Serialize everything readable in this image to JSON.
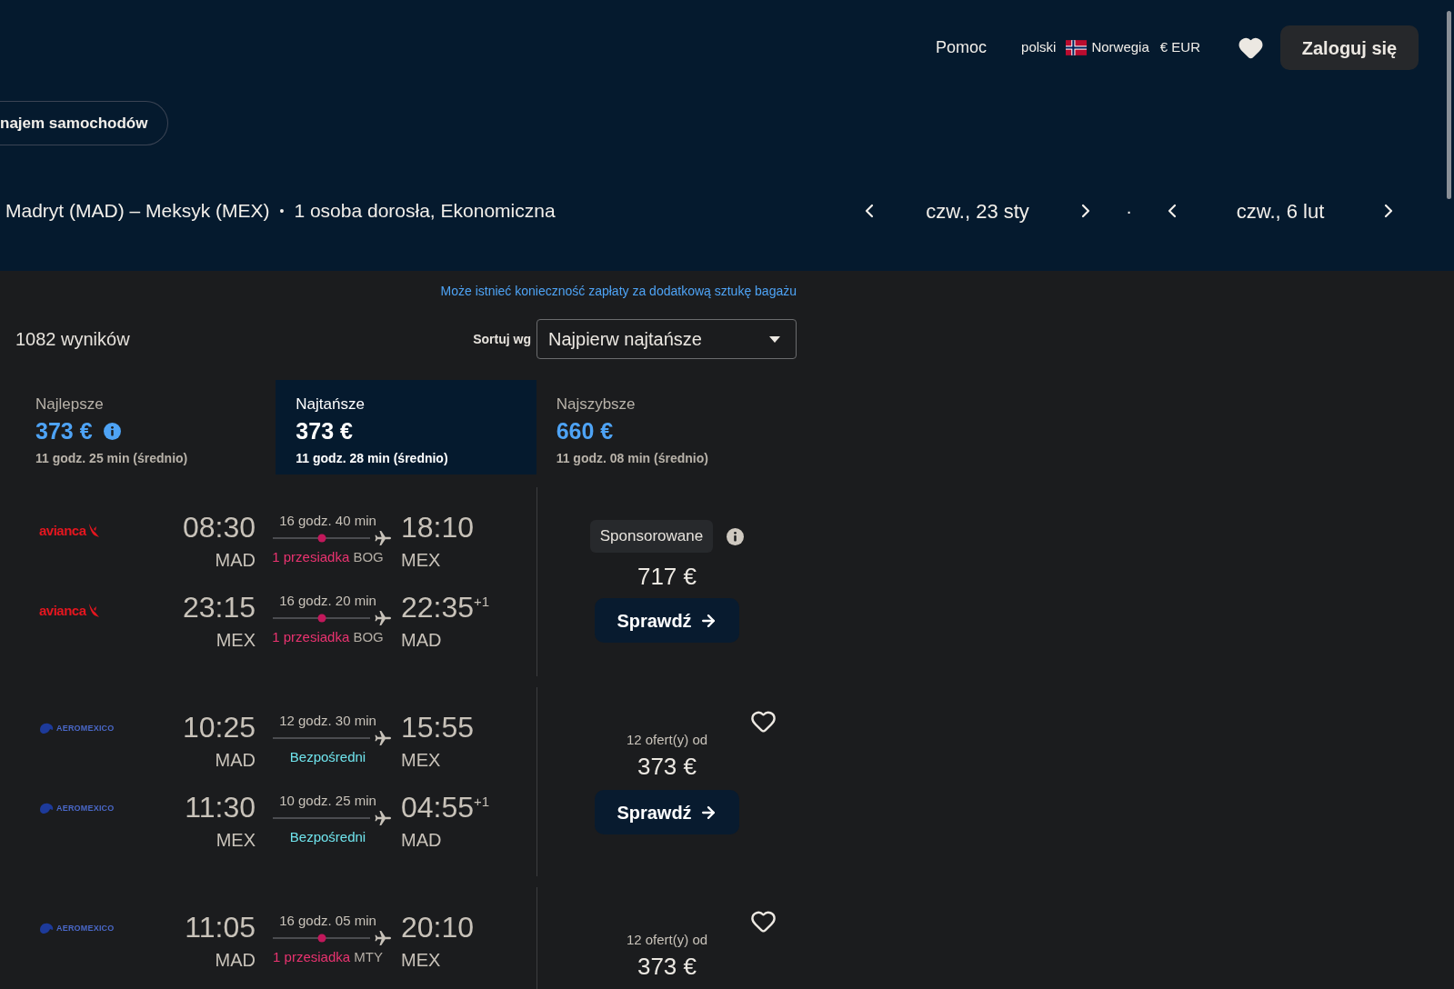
{
  "header": {
    "help_link": "Pomoc",
    "language": "polski",
    "country": "Norwegia",
    "currency": "€ EUR",
    "login_button": "Zaloguj się"
  },
  "category_pill": "najem samochodów",
  "search_summary": {
    "route": "Madryt (MAD) – Meksyk (MEX)",
    "separator": "•",
    "travellers": "1 osoba dorosła, Ekonomiczna",
    "dates": [
      "czw., 23 sty",
      "czw., 6 lut"
    ],
    "date_separator": "·"
  },
  "baggage_notice": "Może istnieć konieczność zapłaty za dodatkową sztukę bagażu",
  "results_count": "1082 wyników",
  "sort": {
    "label": "Sortuj wg",
    "value": "Najpierw najtańsze"
  },
  "sort_tabs": [
    {
      "label": "Najlepsze",
      "price": "373 €",
      "duration": "11 godz. 25 min (średnio)",
      "info": true,
      "selected": false
    },
    {
      "label": "Najtańsze",
      "price": "373 €",
      "duration": "11 godz. 28 min (średnio)",
      "info": false,
      "selected": true
    },
    {
      "label": "Najszybsze",
      "price": "660 €",
      "duration": "11 godz. 08 min (średnio)",
      "info": false,
      "selected": false
    }
  ],
  "results": [
    {
      "sponsored": "Sponsorowane",
      "price": "717 €",
      "button": "Sprawdź",
      "legs": [
        {
          "logo": {
            "kind": "bird",
            "text": "avianca"
          },
          "depart_time": "08:30",
          "depart_airport": "MAD",
          "duration": "16 godz. 40 min",
          "kind": "stop",
          "stops_label": "1 przesiadka",
          "stop_airport": "BOG",
          "arrive_time": "18:10",
          "arrive_airport": "MEX"
        },
        {
          "logo": {
            "kind": "bird",
            "text": "avianca"
          },
          "depart_time": "23:15",
          "depart_airport": "MEX",
          "duration": "16 godz. 20 min",
          "kind": "stop",
          "stops_label": "1 przesiadka",
          "stop_airport": "BOG",
          "arrive_time": "22:35",
          "day_offset": "+1",
          "arrive_airport": "MAD"
        }
      ]
    },
    {
      "saved": false,
      "offers_label": "12 ofert(y) od",
      "price": "373 €",
      "button": "Sprawdź",
      "legs": [
        {
          "logo": {
            "kind": "eagle",
            "text": "AEROMEXICO"
          },
          "depart_time": "10:25",
          "depart_airport": "MAD",
          "duration": "12 godz. 30 min",
          "kind": "direct",
          "stops_label": "Bezpośredni",
          "arrive_time": "15:55",
          "arrive_airport": "MEX"
        },
        {
          "logo": {
            "kind": "eagle",
            "text": "AEROMEXICO"
          },
          "depart_time": "11:30",
          "depart_airport": "MEX",
          "duration": "10 godz. 25 min",
          "kind": "direct",
          "stops_label": "Bezpośredni",
          "arrive_time": "04:55",
          "day_offset": "+1",
          "arrive_airport": "MAD"
        }
      ]
    },
    {
      "saved": false,
      "offers_label": "12 ofert(y) od",
      "price": "373 €",
      "legs": [
        {
          "logo": {
            "kind": "eagle",
            "text": "AEROMEXICO"
          },
          "depart_time": "11:05",
          "depart_airport": "MAD",
          "duration": "16 godz. 05 min",
          "kind": "stop",
          "stops_label": "1 przesiadka",
          "stop_airport": "MTY",
          "arrive_time": "20:10",
          "arrive_airport": "MEX"
        }
      ]
    }
  ]
}
